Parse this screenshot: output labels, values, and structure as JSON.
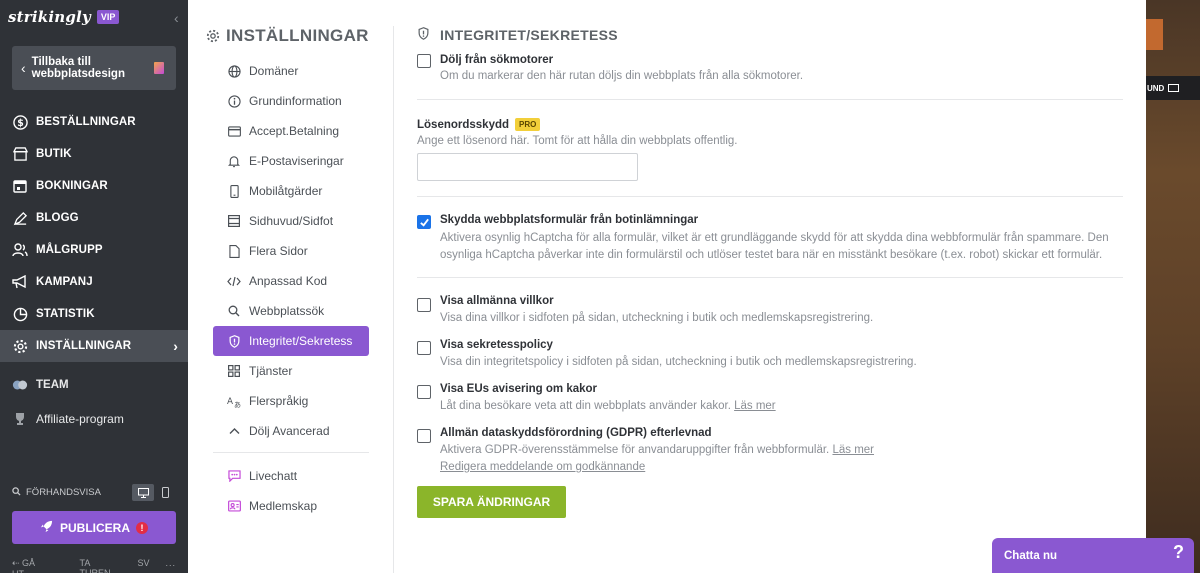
{
  "brand": {
    "logo": "strikingly",
    "badge": "VIP"
  },
  "sidebar": {
    "back_label": "Tillbaka till webbplatsdesign",
    "items": [
      {
        "label": "BESTÄLLNINGAR",
        "icon": "dollar-icon"
      },
      {
        "label": "BUTIK",
        "icon": "shop-icon"
      },
      {
        "label": "BOKNINGAR",
        "icon": "calendar-icon"
      },
      {
        "label": "BLOGG",
        "icon": "pen-icon"
      },
      {
        "label": "MÅLGRUPP",
        "icon": "audience-icon"
      },
      {
        "label": "KAMPANJ",
        "icon": "megaphone-icon"
      },
      {
        "label": "STATISTIK",
        "icon": "chart-icon"
      },
      {
        "label": "INSTÄLLNINGAR",
        "icon": "gear-icon"
      }
    ],
    "team_label": "TEAM",
    "affiliate_label": "Affiliate-program",
    "preview_label": "FÖRHANDSVISA",
    "publish_label": "PUBLICERA",
    "publish_warning": "!",
    "bottom": {
      "logout": "GÅ UT",
      "tour": "TA TUREN",
      "lang": "SV",
      "more": "..."
    }
  },
  "settings_nav": {
    "title": "INSTÄLLNINGAR",
    "items": [
      {
        "label": "Domäner"
      },
      {
        "label": "Grundinformation"
      },
      {
        "label": "Accept.Betalning"
      },
      {
        "label": "E-Postaviseringar"
      },
      {
        "label": "Mobilåtgärder"
      },
      {
        "label": "Sidhuvud/Sidfot"
      },
      {
        "label": "Flera Sidor"
      },
      {
        "label": "Anpassad Kod"
      },
      {
        "label": "Webbplatssök"
      },
      {
        "label": "Integritet/Sekretess"
      },
      {
        "label": "Tjänster"
      },
      {
        "label": "Flerspråkig"
      },
      {
        "label": "Dölj Avancerad"
      }
    ],
    "extra": [
      {
        "label": "Livechatt"
      },
      {
        "label": "Medlemskap"
      }
    ]
  },
  "main": {
    "title": "INTEGRITET/SEKRETESS",
    "hide_search": {
      "title": "Dölj från sökmotorer",
      "desc": "Om du markerar den här rutan döljs din webbplats från alla sökmotorer."
    },
    "password": {
      "title": "Lösenordsskydd",
      "badge": "PRO",
      "desc": "Ange ett lösenord här. Tomt för att hålla din webbplats offentlig.",
      "value": ""
    },
    "bot": {
      "title": "Skydda webbplatsformulär från botinlämningar",
      "desc_line1": "Aktivera osynlig hCaptcha för alla formulär, vilket är ett grundläggande skydd för att skydda dina webbformulär från spammare. Den",
      "desc_line2": "osynliga hCaptcha påverkar inte din formulärstil och utlöser testet bara när en misstänkt besökare (t.ex. robot) skickar ett formulär.",
      "checked": true
    },
    "terms": {
      "title": "Visa allmänna villkor",
      "desc": "Visa dina villkor i sidfoten på sidan, utcheckning i butik och medlemskapsregistrering."
    },
    "privacy": {
      "title": "Visa sekretesspolicy",
      "desc": "Visa din integritetspolicy i sidfoten på sidan, utcheckning i butik och medlemskapsregistrering."
    },
    "cookies": {
      "title": "Visa EUs avisering om kakor",
      "desc": "Låt dina besökare veta att din webbplats använder kakor.",
      "link": "Läs mer"
    },
    "gdpr": {
      "title": "Allmän dataskyddsförordning (GDPR) efterlevnad",
      "desc": "Aktivera GDPR-överensstämmelse för anvandaruppgifter från webbformulär.",
      "link": "Läs mer",
      "edit_link": "Redigera meddelande om godkännande"
    },
    "save_label": "SPARA ÄNDRINGAR"
  },
  "preview_panel": {
    "label": "UND"
  },
  "chat": {
    "label": "Chatta nu",
    "help": "?"
  }
}
